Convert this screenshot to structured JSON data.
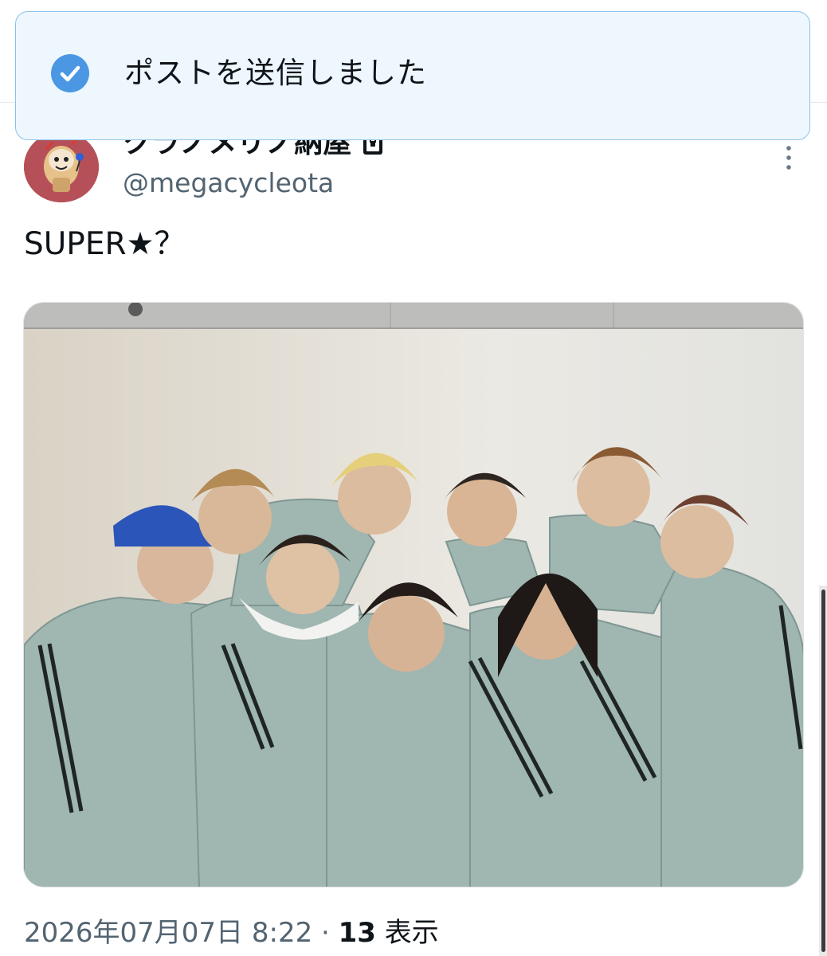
{
  "toast": {
    "icon": "check-circle-icon",
    "message": "ポストを送信しました"
  },
  "post": {
    "display_name": "クラノメリノ納屋",
    "handle": "@megacycleota",
    "lock_icon": "lock-icon",
    "more_icon": "more-vertical-icon",
    "text": "SUPER★？",
    "timestamp": "2026年07月07日 8:22 · ",
    "views_count": "13",
    "views_label": " 表示"
  },
  "colors": {
    "toast_bg": "#eef7fd",
    "toast_border": "#8dc2ea",
    "check_blue": "#4b97e3",
    "secondary_text": "#536471",
    "primary_text": "#0f1419"
  }
}
